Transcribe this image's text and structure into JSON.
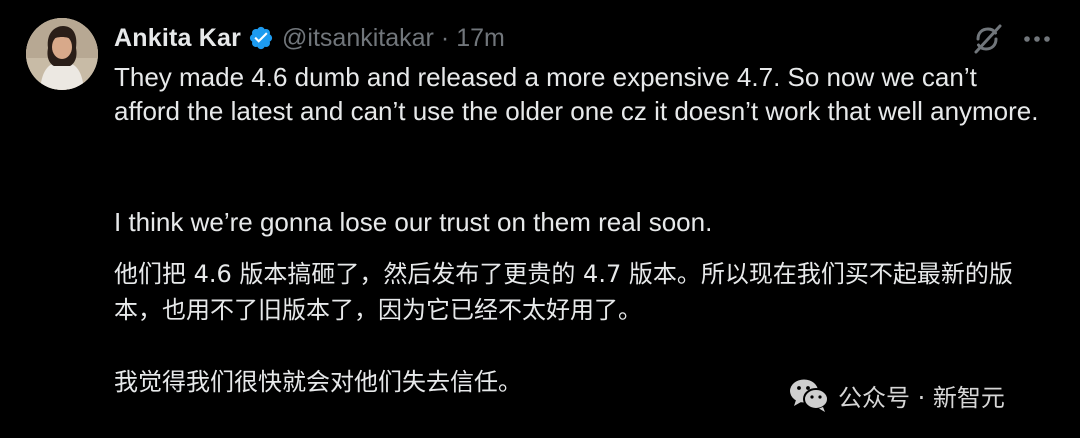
{
  "tweet": {
    "author": {
      "name": "Ankita Kar",
      "handle": "@itsankitakar",
      "time": "17m",
      "separator": "·"
    },
    "paragraphs": {
      "p1": "They made 4.6 dumb and released a more expensive 4.7. So now we can’t afford the latest and can’t use the older one cz it doesn’t work that well anymore.",
      "p2": "I think we’re gonna lose our trust on them real soon.",
      "p3": "他们把 4.6 版本搞砸了，然后发布了更贵的 4.7 版本。所以现在我们买不起最新的版本，也用不了旧版本了，因为它已经不太好用了。",
      "p4": "我觉得我们很快就会对他们失去信任。"
    },
    "icons": {
      "verified": "verified-badge-icon",
      "grok": "grok-icon",
      "more": "more-icon"
    }
  },
  "watermark": {
    "text": "公众号 · 新智元",
    "icon": "wechat-icon"
  },
  "colors": {
    "background": "#000000",
    "text": "#e7e9ea",
    "muted": "#71767b",
    "verified": "#1d9bf0"
  }
}
